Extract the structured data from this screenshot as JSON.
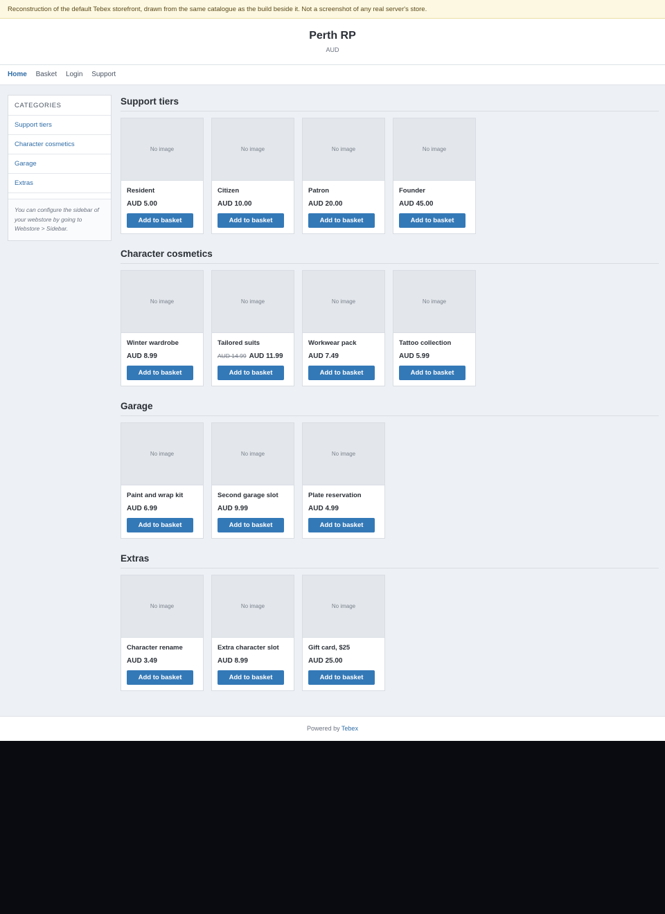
{
  "notice": "Reconstruction of the default Tebex storefront, drawn from the same catalogue as the build beside it. Not a screenshot of any real server's store.",
  "header": {
    "title": "Perth RP",
    "currency": "AUD"
  },
  "nav": {
    "home": "Home",
    "basket": "Basket",
    "login": "Login",
    "support": "Support"
  },
  "sidebar": {
    "heading": "CATEGORIES",
    "items": [
      {
        "label": "Support tiers"
      },
      {
        "label": "Character cosmetics"
      },
      {
        "label": "Garage"
      },
      {
        "label": "Extras"
      }
    ],
    "note": "You can configure the sidebar of your webstore by going to Webstore > Sidebar."
  },
  "no_image": "No image",
  "add_to_basket": "Add to basket",
  "sections": [
    {
      "title": "Support tiers",
      "products": [
        {
          "name": "Resident",
          "price": "AUD 5.00",
          "old_price": ""
        },
        {
          "name": "Citizen",
          "price": "AUD 10.00",
          "old_price": ""
        },
        {
          "name": "Patron",
          "price": "AUD 20.00",
          "old_price": ""
        },
        {
          "name": "Founder",
          "price": "AUD 45.00",
          "old_price": ""
        }
      ]
    },
    {
      "title": "Character cosmetics",
      "products": [
        {
          "name": "Winter wardrobe",
          "price": "AUD 8.99",
          "old_price": ""
        },
        {
          "name": "Tailored suits",
          "price": "AUD 11.99",
          "old_price": "AUD 14.99"
        },
        {
          "name": "Workwear pack",
          "price": "AUD 7.49",
          "old_price": ""
        },
        {
          "name": "Tattoo collection",
          "price": "AUD 5.99",
          "old_price": ""
        }
      ]
    },
    {
      "title": "Garage",
      "products": [
        {
          "name": "Paint and wrap kit",
          "price": "AUD 6.99",
          "old_price": ""
        },
        {
          "name": "Second garage slot",
          "price": "AUD 9.99",
          "old_price": ""
        },
        {
          "name": "Plate reservation",
          "price": "AUD 4.99",
          "old_price": ""
        }
      ]
    },
    {
      "title": "Extras",
      "products": [
        {
          "name": "Character rename",
          "price": "AUD 3.49",
          "old_price": ""
        },
        {
          "name": "Extra character slot",
          "price": "AUD 8.99",
          "old_price": ""
        },
        {
          "name": "Gift card, $25",
          "price": "AUD 25.00",
          "old_price": ""
        }
      ]
    }
  ],
  "footer": {
    "prefix": "Powered by",
    "link": "Tebex"
  }
}
